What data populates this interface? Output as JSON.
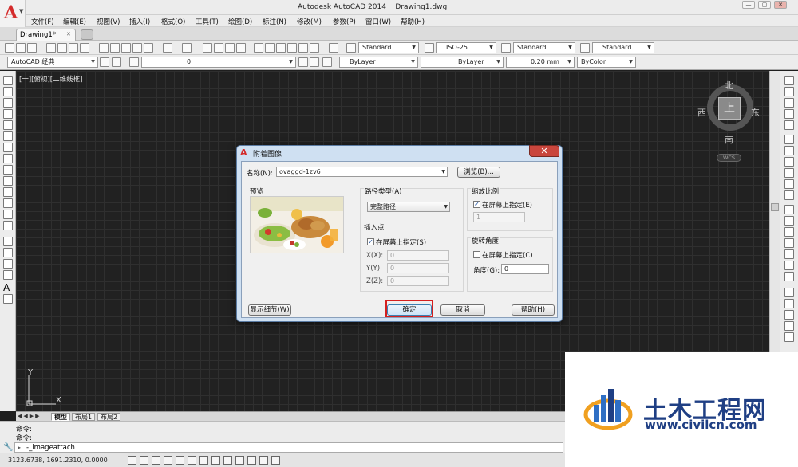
{
  "window": {
    "title": "Autodesk AutoCAD 2014    Drawing1.dwg",
    "controls": [
      "—",
      "▢",
      "✕"
    ]
  },
  "menu": [
    "文件(F)",
    "编辑(E)",
    "视图(V)",
    "插入(I)",
    "格式(O)",
    "工具(T)",
    "绘图(D)",
    "标注(N)",
    "修改(M)",
    "参数(P)",
    "窗口(W)",
    "帮助(H)"
  ],
  "tabs": {
    "drawing": "Drawing1*",
    "close": "✕"
  },
  "toolbar": {
    "text_style": "Standard",
    "dim_style": "ISO-25",
    "table_style": "Standard",
    "mleader_style": "Standard",
    "workspace": "AutoCAD 经典",
    "layer": "0",
    "color": "ByLayer",
    "linetype": "ByLayer",
    "lineweight": "0.20 mm",
    "plotstyle": "ByColor"
  },
  "viewport": {
    "label": "[一][俯视][二维线框]"
  },
  "viewcube": {
    "north": "北",
    "south": "南",
    "east": "东",
    "west": "西",
    "face": "上",
    "wcs": "WCS"
  },
  "ucs": {
    "x": "X",
    "y": "Y"
  },
  "layout_tabs": [
    "模型",
    "布局1",
    "布局2"
  ],
  "command": {
    "line1": "命令:",
    "line2": "命令:",
    "input": "-_imageattach"
  },
  "status": {
    "coords": "3123.6738, 1691.2310, 0.0000"
  },
  "dialog": {
    "title": "附着图像",
    "close": "✕",
    "name_label": "名称(N):",
    "name_value": "ovaggd-1zv6",
    "browse": "浏览(B)...",
    "preview_label": "预览",
    "path_type_label": "路径类型(A)",
    "path_type_value": "完整路径",
    "insert_label": "插入点",
    "insert_onscreen": "在屏幕上指定(S)",
    "x_label": "X(X):",
    "x_value": "0",
    "y_label": "Y(Y):",
    "y_value": "0",
    "z_label": "Z(Z):",
    "z_value": "0",
    "scale_label": "缩放比例",
    "scale_onscreen": "在屏幕上指定(E)",
    "scale_value": "1",
    "rotation_label": "旋转角度",
    "rotation_onscreen": "在屏幕上指定(C)",
    "angle_label": "角度(G):",
    "angle_value": "0",
    "details": "显示细节(W)",
    "ok": "确定",
    "cancel": "取消",
    "help": "帮助(H)"
  },
  "watermark": {
    "title": "土木工程网",
    "url": "www.civilcn.com"
  },
  "colors": {
    "canvas": "#212121",
    "accent": "#d4201f",
    "brand": "#1f3f84"
  }
}
